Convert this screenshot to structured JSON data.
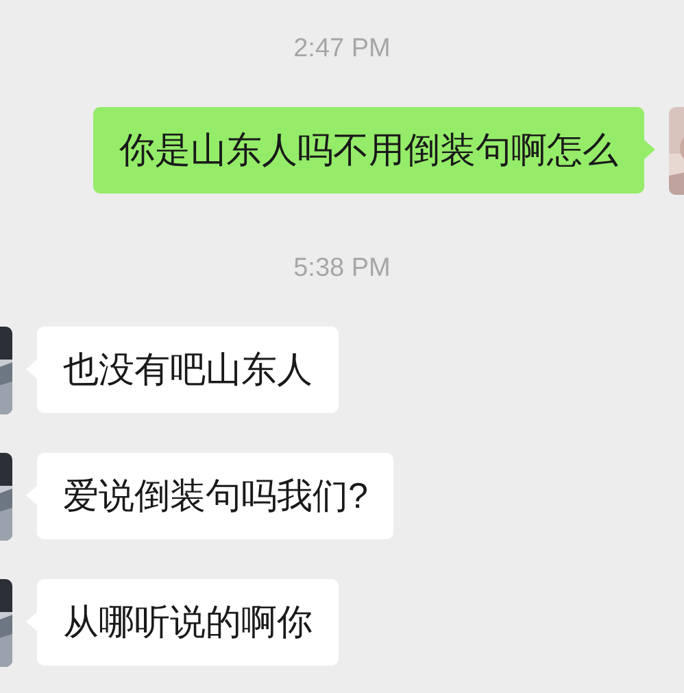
{
  "messages": [
    {
      "kind": "time",
      "text": "2:47 PM"
    },
    {
      "kind": "sent",
      "text": "你是山东人吗不用倒装句啊怎么"
    },
    {
      "kind": "time",
      "text": "5:38 PM"
    },
    {
      "kind": "received",
      "text": "也没有吧山东人"
    },
    {
      "kind": "received",
      "text": "爱说倒装句吗我们?"
    },
    {
      "kind": "received",
      "text": "从哪听说的啊你"
    }
  ]
}
